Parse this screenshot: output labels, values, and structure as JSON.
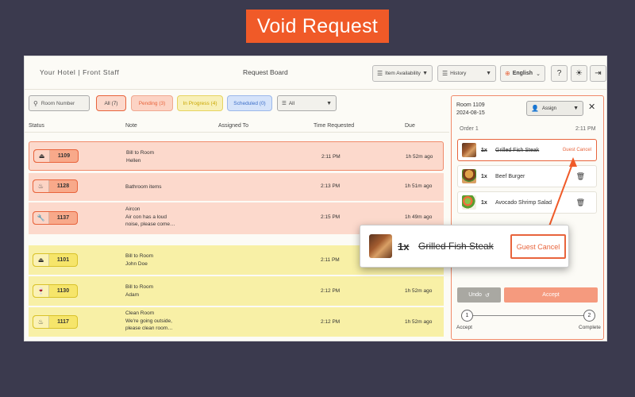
{
  "banner": {
    "title": "Void Request"
  },
  "topbar": {
    "hotel_name": "Your Hotel | Front Staff",
    "board_title": "Request Board",
    "item_availability": "Item Availability",
    "history": "History",
    "language": "English"
  },
  "filters": {
    "search_placeholder": "Room Number",
    "chips": {
      "all": "All (7)",
      "pending": "Pending (3)",
      "in_progress": "In Progress (4)",
      "scheduled": "Scheduled (0)"
    },
    "status_select": "All"
  },
  "table": {
    "headers": {
      "status": "Status",
      "note": "Note",
      "assigned": "Assigned To",
      "time": "Time Requested",
      "due": "Due"
    },
    "pending": [
      {
        "room": "1109",
        "icon": "room-service-icon",
        "note": [
          "Bill to Room",
          "Hellen"
        ],
        "time": "2:11 PM",
        "due": "1h 52m ago"
      },
      {
        "room": "1128",
        "icon": "toiletries-icon",
        "note": [
          "Bathroom items"
        ],
        "time": "2:13 PM",
        "due": "1h 51m ago"
      },
      {
        "room": "1137",
        "icon": "wrench-icon",
        "note": [
          "Aircon",
          "Air con has a loud",
          "noise, please come…"
        ],
        "time": "2:15 PM",
        "due": "1h 49m ago"
      }
    ],
    "in_progress": [
      {
        "room": "1101",
        "icon": "room-service-icon",
        "note": [
          "Bill to Room",
          "John Doe"
        ],
        "time": "2:11 PM",
        "due": ""
      },
      {
        "room": "1130",
        "icon": "drinks-icon",
        "note": [
          "Bill to Room",
          "Adam"
        ],
        "time": "2:12 PM",
        "due": "1h 52m ago"
      },
      {
        "room": "1117",
        "icon": "toiletries-icon",
        "note": [
          "Clean Room",
          "We're going outside,",
          "please clean room…"
        ],
        "time": "2:12 PM",
        "due": "1h 52m ago"
      }
    ]
  },
  "panel": {
    "room": "Room 1109",
    "date": "2024-08-15",
    "assign": "Assign",
    "order_label": "Order 1",
    "order_time": "2:11 PM",
    "items": [
      {
        "qty": "1x",
        "name": "Grilled Fish Steak",
        "tag": "Guest Cancel"
      },
      {
        "qty": "1x",
        "name": "Beef Burger"
      },
      {
        "qty": "1x",
        "name": "Avocado Shrimp Salad"
      }
    ],
    "undo": "Undo",
    "accept": "Accept",
    "steps": {
      "one": "1",
      "two": "2",
      "accept_label": "Accept",
      "complete_label": "Complete"
    }
  },
  "zoom": {
    "qty": "1x",
    "name": "Grilled Fish Steak",
    "tag": "Guest Cancel"
  },
  "colors": {
    "accent": "#f05a28",
    "pending_row": "#fcd9cc",
    "progress_row": "#f8f0a6",
    "background": "#3b3a4e"
  }
}
